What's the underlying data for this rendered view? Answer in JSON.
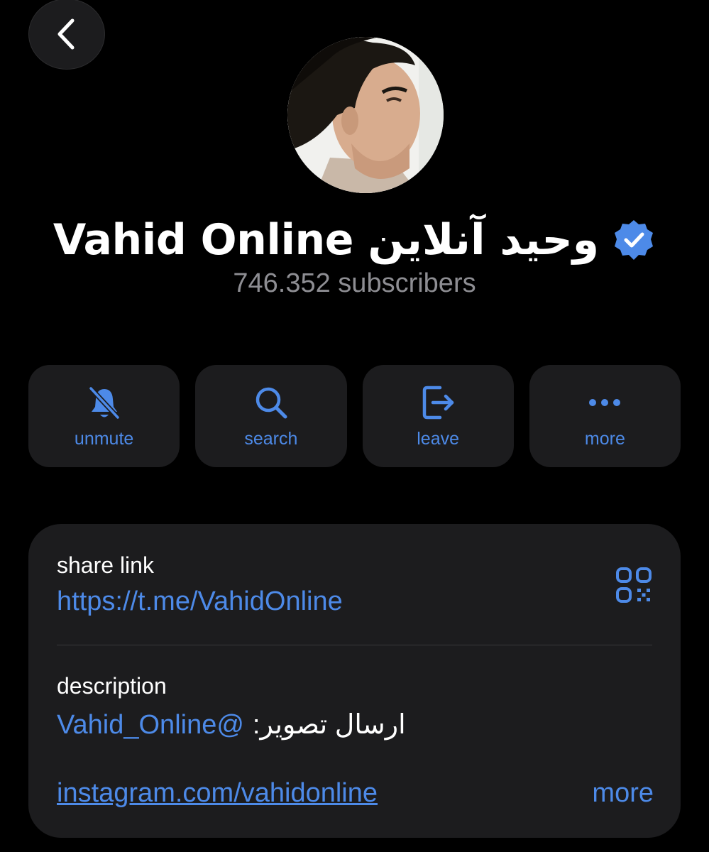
{
  "channel": {
    "name": "Vahid Online وحید آنلاین",
    "subscribers": "746.352 subscribers",
    "verified_icon": "verified-badge-icon"
  },
  "actions": [
    {
      "label": "unmute",
      "icon": "bell-slash-icon"
    },
    {
      "label": "search",
      "icon": "search-icon"
    },
    {
      "label": "leave",
      "icon": "leave-icon"
    },
    {
      "label": "more",
      "icon": "ellipsis-icon"
    }
  ],
  "info": {
    "share_label": "share link",
    "share_url": "https://t.me/VahidOnline",
    "description_label": "description",
    "description_handle": "Vahid_Online@",
    "description_text": "ارسال تصویر:",
    "instagram": "instagram.com/vahidonline",
    "more_label": "more"
  },
  "colors": {
    "background": "#000000",
    "card": "#1c1c1e",
    "accent": "#4d8ae8",
    "secondary_text": "#8e8e93"
  }
}
